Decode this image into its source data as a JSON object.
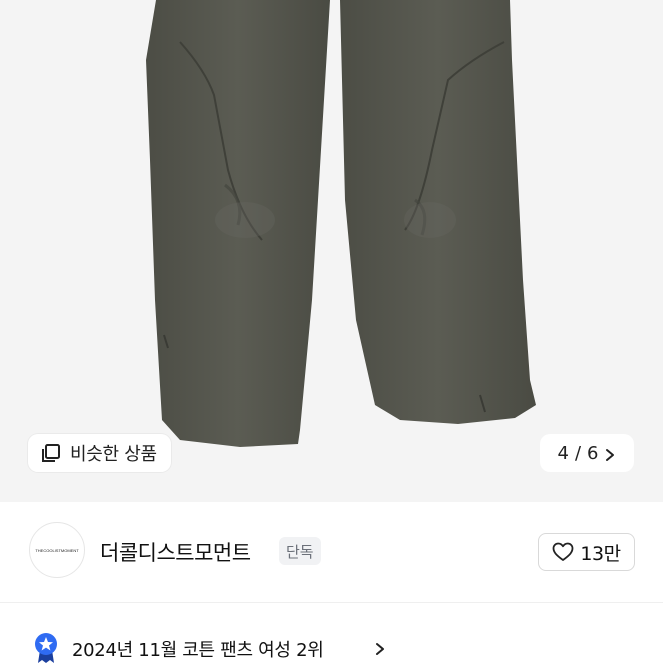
{
  "product": {
    "similar_label": "비슷한 상품",
    "pager": {
      "current": "4",
      "separator": "/",
      "total": "6"
    }
  },
  "store": {
    "logo_text": "THECOOLISTMOMENT",
    "name": "더콜디스트모먼트",
    "badge": "단독",
    "like_count": "13만"
  },
  "ranking": {
    "text": "2024년 11월 코튼 팬츠 여성 2위"
  },
  "colors": {
    "hero_background": "#f4f4f4",
    "pants": "#55564d",
    "badge_bg": "#f1f2f4",
    "rank_badge": "#2f6bf2"
  },
  "icons": {
    "similar": "stacked-squares-icon",
    "pager_next": "chevron-right-icon",
    "like": "heart-outline-icon",
    "rank": "star-ribbon-badge-icon",
    "rank_next": "chevron-right-icon"
  }
}
